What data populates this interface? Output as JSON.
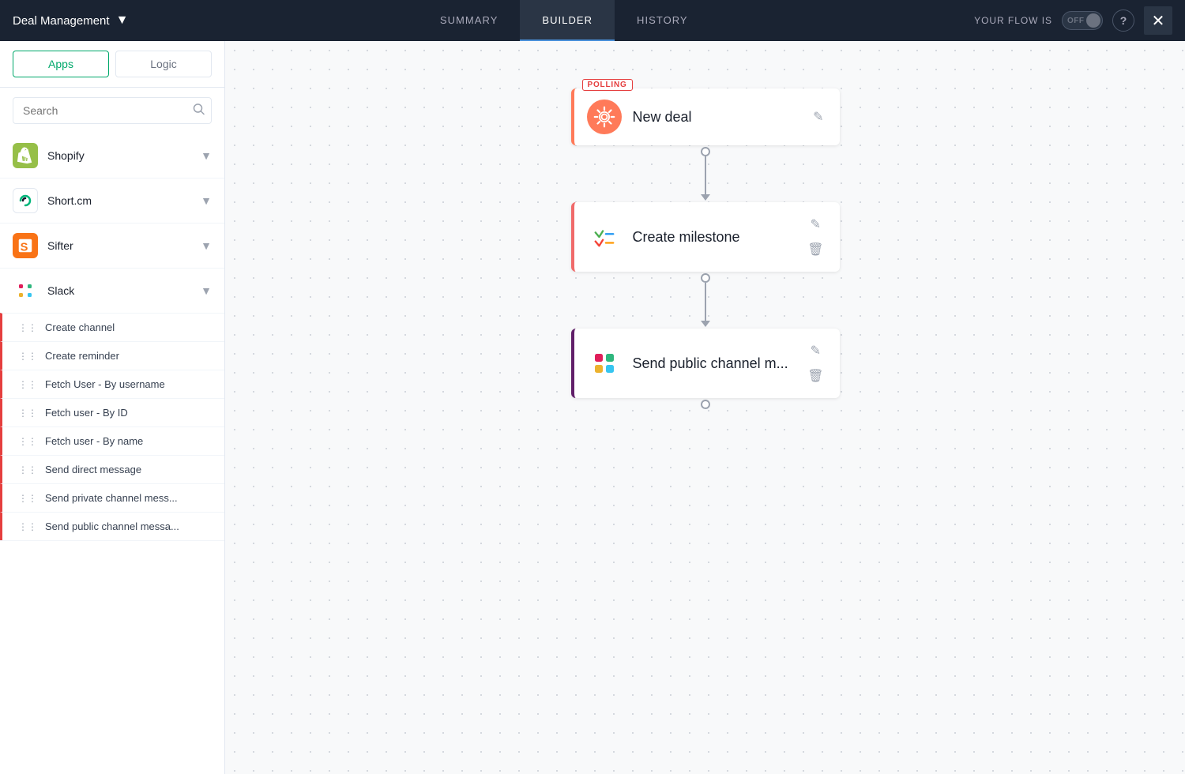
{
  "header": {
    "title": "Deal Management",
    "chevron": "▾",
    "tabs": [
      {
        "id": "summary",
        "label": "SUMMARY",
        "active": false
      },
      {
        "id": "builder",
        "label": "BUILDER",
        "active": true
      },
      {
        "id": "history",
        "label": "HISTORY",
        "active": false
      }
    ],
    "flow_label": "YOUR FLOW IS",
    "toggle_text": "OFF",
    "help_label": "?",
    "close_label": "✕"
  },
  "sidebar": {
    "tabs": [
      {
        "id": "apps",
        "label": "Apps",
        "active": true
      },
      {
        "id": "logic",
        "label": "Logic",
        "active": false
      }
    ],
    "search_placeholder": "Search",
    "apps": [
      {
        "id": "shopify",
        "name": "Shopify",
        "expanded": false
      },
      {
        "id": "shortcm",
        "name": "Short.cm",
        "expanded": false
      },
      {
        "id": "sifter",
        "name": "Sifter",
        "expanded": false
      },
      {
        "id": "slack",
        "name": "Slack",
        "expanded": true
      }
    ],
    "slack_items": [
      {
        "id": "create-channel",
        "label": "Create channel"
      },
      {
        "id": "create-reminder",
        "label": "Create reminder"
      },
      {
        "id": "fetch-user-username",
        "label": "Fetch User - By username"
      },
      {
        "id": "fetch-user-id",
        "label": "Fetch user - By ID"
      },
      {
        "id": "fetch-user-name",
        "label": "Fetch user - By name"
      },
      {
        "id": "send-direct",
        "label": "Send direct message"
      },
      {
        "id": "send-private",
        "label": "Send private channel mess..."
      },
      {
        "id": "send-public",
        "label": "Send public channel messa..."
      }
    ]
  },
  "canvas": {
    "nodes": [
      {
        "id": "new-deal",
        "label": "New deal",
        "type": "hubspot",
        "badge": "POLLING",
        "has_delete": false
      },
      {
        "id": "create-milestone",
        "label": "Create milestone",
        "type": "asana",
        "badge": null,
        "has_delete": true
      },
      {
        "id": "send-channel",
        "label": "Send public channel m...",
        "type": "slack",
        "badge": null,
        "has_delete": true
      }
    ]
  }
}
